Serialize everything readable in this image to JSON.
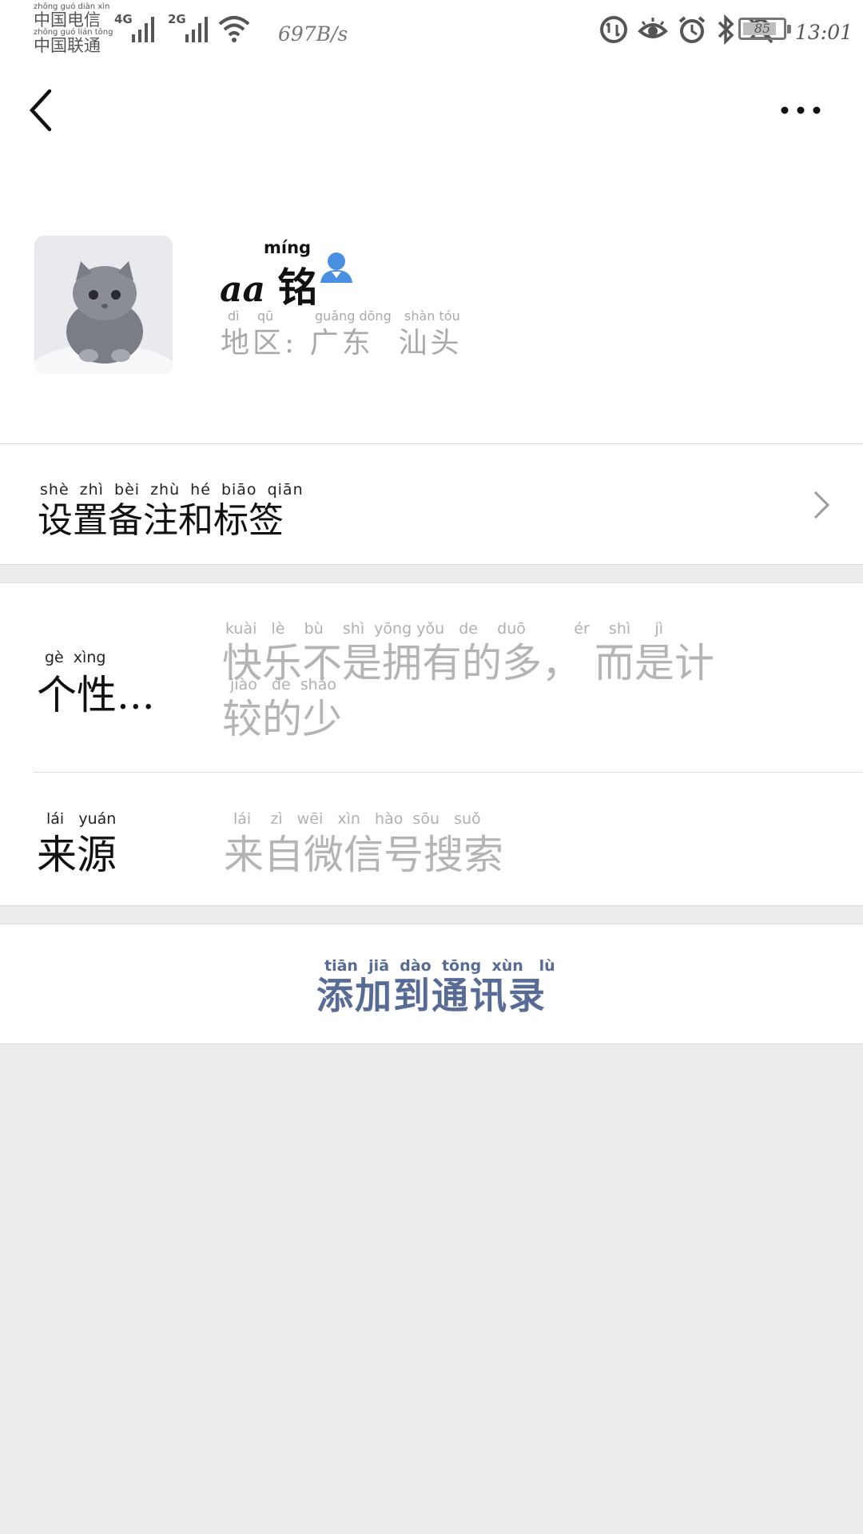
{
  "status_bar": {
    "carrier_1": "中国电信",
    "carrier_1_pinyin": "zhōng guó diàn xìn",
    "carrier_2": "中国联通",
    "carrier_2_pinyin": "zhōng guó lián tōng",
    "network_1": "4G",
    "network_2": "2G",
    "speed": "697B/s",
    "battery": "85",
    "time": "13:01",
    "icons": [
      "data-saver-icon",
      "eye-comfort-icon",
      "alarm-icon",
      "bluetooth-icon",
      "mute-icon",
      "wifi-icon"
    ]
  },
  "nav": {
    "back_icon": "back-chevron-icon",
    "more_icon": "more-dots-icon"
  },
  "profile": {
    "name_prefix": "aa",
    "name_char": "铭",
    "name_pinyin": "míng",
    "region_label": "地区:",
    "region_value": "广东  汕头",
    "region_pinyin": [
      "dì",
      "qū",
      "guǎng dōng",
      "shàn tóu"
    ],
    "contact_icon": "contact-person-icon"
  },
  "remark_row": {
    "label": "设置备注和标签",
    "pinyin": "shè  zhì  bèi  zhù  hé  biāo  qiān"
  },
  "signature_row": {
    "label": "个性...",
    "label_pinyin": "gè   xìng",
    "value_line1": "快乐不是拥有的多， 而是计",
    "value_line1_pinyin": "kuài   lè    bù    shì  yōng yǒu   de    duō          ér    shì     jì",
    "value_line2": "较的少",
    "value_line2_pinyin": "jiào   de  shǎo"
  },
  "source_row": {
    "label": "来源",
    "label_pinyin": "lái   yuán",
    "value": "来自微信号搜索",
    "value_pinyin": "lái    zì   wēi   xìn   hào  sōu   suǒ"
  },
  "action": {
    "add_label": "添加到通讯录",
    "add_pinyin": "tiān  jiā  dào  tōng  xùn   lù"
  },
  "colors": {
    "link_blue": "#576b95",
    "grey_text": "#b4b4b4",
    "background": "#ededed",
    "contact_icon_blue": "#4a90e2"
  }
}
